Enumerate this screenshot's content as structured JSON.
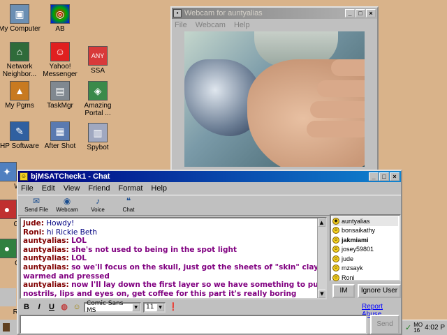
{
  "desktop": {
    "icons": [
      {
        "label": "My Computer",
        "icon": "computer-icon"
      },
      {
        "label": "AB",
        "icon": "ab-icon"
      },
      {
        "label": "Network Neighbor...",
        "icon": "network-icon"
      },
      {
        "label": "Yahoo! Messenger",
        "icon": "yahoo-icon"
      },
      {
        "label": "SSA",
        "icon": "ssa-icon"
      },
      {
        "label": "My Pgms",
        "icon": "folder-icon"
      },
      {
        "label": "TaskMgr",
        "icon": "taskmgr-icon"
      },
      {
        "label": "Amazing Portal ...",
        "icon": "portal-icon"
      },
      {
        "label": "HP Software",
        "icon": "hp-icon"
      },
      {
        "label": "After Shot",
        "icon": "aftershot-icon"
      },
      {
        "label": "Spybot",
        "icon": "spybot-icon"
      },
      {
        "label": "W",
        "icon": "w-icon"
      },
      {
        "label": "Gr",
        "icon": "gr-icon"
      },
      {
        "label": "G",
        "icon": "g-icon"
      },
      {
        "label": "Re",
        "icon": "re-icon"
      }
    ]
  },
  "webcam": {
    "title": "Webcam for auntyalias",
    "menu": [
      "File",
      "Webcam",
      "Help"
    ]
  },
  "chat": {
    "title": "bjMSATCheck1 - Chat",
    "menu": [
      "File",
      "Edit",
      "View",
      "Friend",
      "Format",
      "Help"
    ],
    "toolbar": [
      "Send File",
      "Webcam",
      "Voice",
      "Chat"
    ],
    "messages": [
      {
        "name": "jude:",
        "text": "Howdy!",
        "style": "plain"
      },
      {
        "name": "Roni:",
        "text": "hi Rickie Beth",
        "style": "plain"
      },
      {
        "name": "auntyalias:",
        "text": "LOL",
        "style": "bold"
      },
      {
        "name": "auntyalias:",
        "text": "she's not used to being in the spot light",
        "style": "bold"
      },
      {
        "name": "auntyalias:",
        "text": "LOL",
        "style": "bold"
      },
      {
        "name": "auntyalias:",
        "text": "so we'll focus on the skull, just got the sheets of \"skin\" clay warmed and pressed",
        "style": "bold"
      },
      {
        "name": "auntyalias:",
        "text": "now I'll lay down the first layer so we have something to put nostrils, lips and eyes on, get coffee for this part it's really boring",
        "style": "bold"
      }
    ],
    "users": [
      {
        "name": "auntyalias",
        "bold": false,
        "selected": true
      },
      {
        "name": "bonsaikathy",
        "bold": false,
        "selected": false
      },
      {
        "name": "jakmiami",
        "bold": true,
        "selected": false
      },
      {
        "name": "josey59801",
        "bold": false,
        "selected": false
      },
      {
        "name": "jude",
        "bold": false,
        "selected": false
      },
      {
        "name": "mzsayk",
        "bold": false,
        "selected": false
      },
      {
        "name": "Roni",
        "bold": false,
        "selected": false
      }
    ],
    "im_button": "IM",
    "ignore_button": "Ignore User",
    "report_abuse": "Report Abuse",
    "font_name": "Comic Sans MS",
    "font_size": "11",
    "send_button": "Send"
  },
  "tray": {
    "clock": "4:02 P",
    "day": "MO 16"
  }
}
